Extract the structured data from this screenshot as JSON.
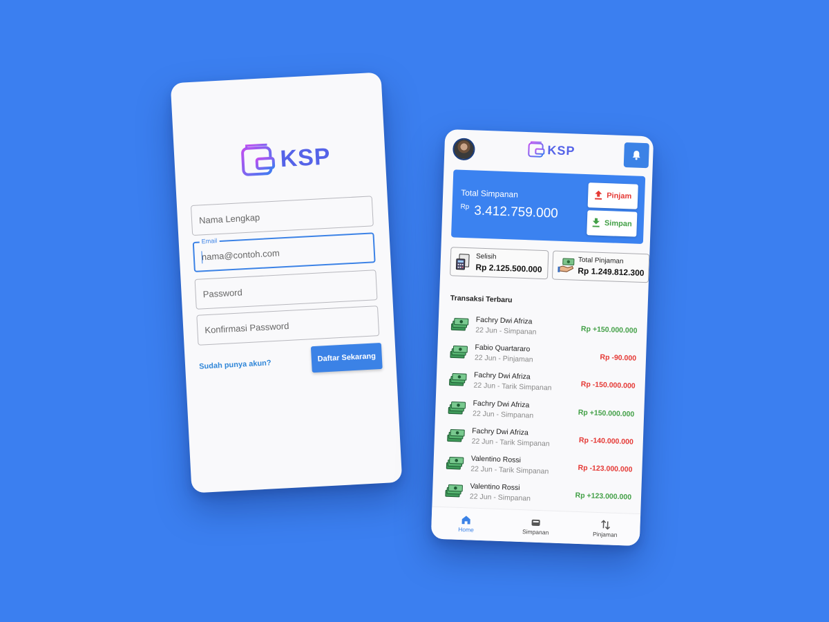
{
  "register": {
    "brand": "KSP",
    "fields": {
      "nama": {
        "placeholder": "Nama Lengkap",
        "value": ""
      },
      "email": {
        "label": "Email",
        "placeholder": "nama@contoh.com",
        "value": ""
      },
      "password": {
        "placeholder": "Password",
        "value": ""
      },
      "konfirmasi": {
        "placeholder": "Konfirmasi Password",
        "value": ""
      }
    },
    "login_link": "Sudah punya akun?",
    "submit_label": "Daftar Sekarang"
  },
  "home": {
    "brand": "KSP",
    "balance": {
      "title": "Total Simpanan",
      "currency": "Rp",
      "amount": "3.412.759.000"
    },
    "actions": {
      "pinjam": "Pinjam",
      "simpan": "Simpan"
    },
    "stats": {
      "selisih": {
        "label": "Selisih",
        "value": "Rp 2.125.500.000"
      },
      "pinjaman": {
        "label": "Total Pinjaman",
        "value": "Rp 1.249.812.300"
      }
    },
    "section_title": "Transaksi Terbaru",
    "transactions": [
      {
        "name": "Fachry Dwi Afriza",
        "meta": "22 Jun - Simpanan",
        "amount": "Rp +150.000.000",
        "type": "plus"
      },
      {
        "name": "Fabio Quartararo",
        "meta": "22 Jun - Pinjaman",
        "amount": "Rp -90.000",
        "type": "minus"
      },
      {
        "name": "Fachry Dwi Afriza",
        "meta": "22 Jun - Tarik Simpanan",
        "amount": "Rp -150.000.000",
        "type": "minus"
      },
      {
        "name": "Fachry Dwi Afriza",
        "meta": "22 Jun - Simpanan",
        "amount": "Rp +150.000.000",
        "type": "plus"
      },
      {
        "name": "Fachry Dwi Afriza",
        "meta": "22 Jun - Tarik Simpanan",
        "amount": "Rp -140.000.000",
        "type": "minus"
      },
      {
        "name": "Valentino Rossi",
        "meta": "22 Jun - Tarik Simpanan",
        "amount": "Rp -123.000.000",
        "type": "minus"
      },
      {
        "name": "Valentino Rossi",
        "meta": "22 Jun - Simpanan",
        "amount": "Rp +123.000.000",
        "type": "plus"
      }
    ],
    "nav": [
      {
        "label": "Home",
        "icon": "home-icon",
        "active": true
      },
      {
        "label": "Simpanan",
        "icon": "wallet-icon",
        "active": false
      },
      {
        "label": "Pinjaman",
        "icon": "transfer-icon",
        "active": false
      }
    ]
  },
  "colors": {
    "background": "#3b7ff0",
    "accent": "#3b82e6",
    "positive": "#43a047",
    "negative": "#e53935",
    "brand": "#5563e8"
  }
}
